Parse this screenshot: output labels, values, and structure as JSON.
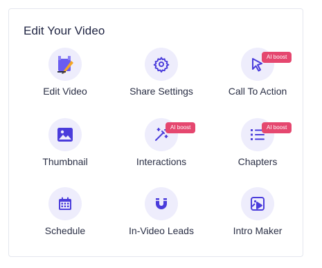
{
  "card": {
    "title": "Edit Your Video"
  },
  "colors": {
    "accent": "#4a3cdb",
    "icon_bg": "#eeedfc",
    "badge_bg": "#e5476f",
    "title_text": "#1d2240",
    "label_text": "#2a2f45"
  },
  "items": [
    {
      "label": "Edit Video",
      "icon": "edit-video-icon",
      "badge": ""
    },
    {
      "label": "Share Settings",
      "icon": "gear-icon",
      "badge": ""
    },
    {
      "label": "Call To Action",
      "icon": "cursor-icon",
      "badge": "AI boost"
    },
    {
      "label": "Thumbnail",
      "icon": "image-icon",
      "badge": ""
    },
    {
      "label": "Interactions",
      "icon": "magic-wand-icon",
      "badge": "AI boost"
    },
    {
      "label": "Chapters",
      "icon": "list-icon",
      "badge": "AI boost"
    },
    {
      "label": "Schedule",
      "icon": "calendar-icon",
      "badge": ""
    },
    {
      "label": "In-Video Leads",
      "icon": "magnet-icon",
      "badge": ""
    },
    {
      "label": "Intro Maker",
      "icon": "video-intro-icon",
      "badge": ""
    }
  ]
}
